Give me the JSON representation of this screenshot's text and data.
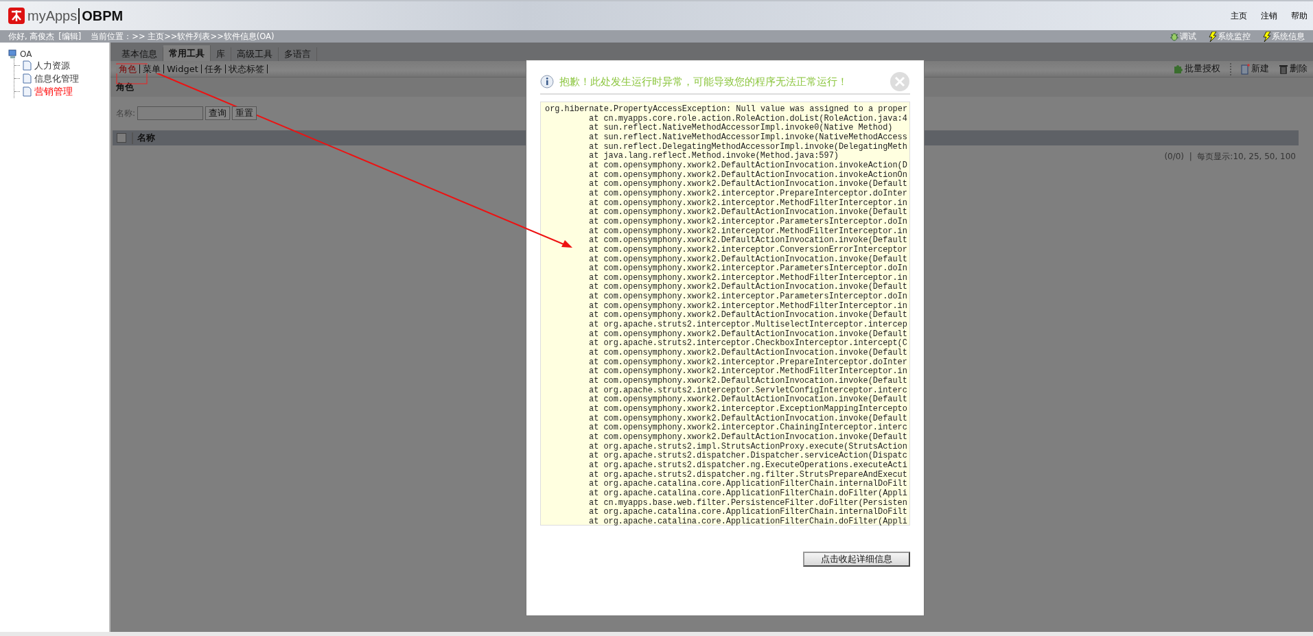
{
  "header": {
    "logo_text": "myApps",
    "product": "OBPM",
    "links": [
      "主页",
      "注销",
      "帮助"
    ]
  },
  "info_bar": {
    "greeting": "你好, 高俊杰",
    "edit_link": "[编辑]",
    "location": "当前位置：>> 主页>>软件列表>>软件信息(OA)",
    "tools": [
      {
        "kind": "debug",
        "label": "调试"
      },
      {
        "kind": "bolt",
        "label": "系统监控"
      },
      {
        "kind": "bolt",
        "label": "系统信息"
      }
    ]
  },
  "sidebar": {
    "root": "OA",
    "children": [
      {
        "label": "人力资源",
        "selected": false
      },
      {
        "label": "信息化管理",
        "selected": false
      },
      {
        "label": "营销管理",
        "selected": true
      }
    ]
  },
  "tabs": [
    {
      "label": "基本信息",
      "selected": false
    },
    {
      "label": "常用工具",
      "selected": true
    },
    {
      "label": "库",
      "selected": false
    },
    {
      "label": "高级工具",
      "selected": false
    },
    {
      "label": "多语言",
      "selected": false
    }
  ],
  "subtabs": [
    {
      "label": "角色",
      "selected": true
    },
    {
      "label": "菜单",
      "selected": false
    },
    {
      "label": "Widget",
      "selected": false
    },
    {
      "label": "任务",
      "selected": false
    },
    {
      "label": "状态标签",
      "selected": false
    }
  ],
  "toolbar": [
    {
      "kind": "puzzle",
      "label": "批量授权"
    },
    {
      "kind": "new",
      "label": "新建"
    },
    {
      "kind": "trash",
      "label": "删除"
    }
  ],
  "section_title": "角色",
  "search": {
    "label": "名称:",
    "buttons": [
      "查询",
      "重置"
    ]
  },
  "table": {
    "columns": [
      "名称"
    ],
    "select_all_checked": false
  },
  "pagination": "(0/0)  |  每页显示:10, 25, 50, 100",
  "dialog": {
    "title": "抱歉！此处发生运行时异常，可能导致您的程序无法正常运行！",
    "exception": "org.hibernate.PropertyAccessException: Null value was assigned to a proper",
    "frames": [
      "at cn.myapps.core.role.action.RoleAction.doList(RoleAction.java:4",
      "at sun.reflect.NativeMethodAccessorImpl.invoke0(Native Method)",
      "at sun.reflect.NativeMethodAccessorImpl.invoke(NativeMethodAccess",
      "at sun.reflect.DelegatingMethodAccessorImpl.invoke(DelegatingMeth",
      "at java.lang.reflect.Method.invoke(Method.java:597)",
      "at com.opensymphony.xwork2.DefaultActionInvocation.invokeAction(D",
      "at com.opensymphony.xwork2.DefaultActionInvocation.invokeActionOn",
      "at com.opensymphony.xwork2.DefaultActionInvocation.invoke(Default",
      "at com.opensymphony.xwork2.interceptor.PrepareInterceptor.doInter",
      "at com.opensymphony.xwork2.interceptor.MethodFilterInterceptor.in",
      "at com.opensymphony.xwork2.DefaultActionInvocation.invoke(Default",
      "at com.opensymphony.xwork2.interceptor.ParametersInterceptor.doIn",
      "at com.opensymphony.xwork2.interceptor.MethodFilterInterceptor.in",
      "at com.opensymphony.xwork2.DefaultActionInvocation.invoke(Default",
      "at com.opensymphony.xwork2.interceptor.ConversionErrorInterceptor",
      "at com.opensymphony.xwork2.DefaultActionInvocation.invoke(Default",
      "at com.opensymphony.xwork2.interceptor.ParametersInterceptor.doIn",
      "at com.opensymphony.xwork2.interceptor.MethodFilterInterceptor.in",
      "at com.opensymphony.xwork2.DefaultActionInvocation.invoke(Default",
      "at com.opensymphony.xwork2.interceptor.ParametersInterceptor.doIn",
      "at com.opensymphony.xwork2.interceptor.MethodFilterInterceptor.in",
      "at com.opensymphony.xwork2.DefaultActionInvocation.invoke(Default",
      "at org.apache.struts2.interceptor.MultiselectInterceptor.intercep",
      "at com.opensymphony.xwork2.DefaultActionInvocation.invoke(Default",
      "at org.apache.struts2.interceptor.CheckboxInterceptor.intercept(C",
      "at com.opensymphony.xwork2.DefaultActionInvocation.invoke(Default",
      "at com.opensymphony.xwork2.interceptor.PrepareInterceptor.doInter",
      "at com.opensymphony.xwork2.interceptor.MethodFilterInterceptor.in",
      "at com.opensymphony.xwork2.DefaultActionInvocation.invoke(Default",
      "at org.apache.struts2.interceptor.ServletConfigInterceptor.interc",
      "at com.opensymphony.xwork2.DefaultActionInvocation.invoke(Default",
      "at com.opensymphony.xwork2.interceptor.ExceptionMappingIntercepto",
      "at com.opensymphony.xwork2.DefaultActionInvocation.invoke(Default",
      "at com.opensymphony.xwork2.interceptor.ChainingInterceptor.interc",
      "at com.opensymphony.xwork2.DefaultActionInvocation.invoke(Default",
      "at org.apache.struts2.impl.StrutsActionProxy.execute(StrutsAction",
      "at org.apache.struts2.dispatcher.Dispatcher.serviceAction(Dispatc",
      "at org.apache.struts2.dispatcher.ng.ExecuteOperations.executeActi",
      "at org.apache.struts2.dispatcher.ng.filter.StrutsPrepareAndExecut",
      "at org.apache.catalina.core.ApplicationFilterChain.internalDoFilt",
      "at org.apache.catalina.core.ApplicationFilterChain.doFilter(Appli",
      "at cn.myapps.base.web.filter.PersistenceFilter.doFilter(Persisten",
      "at org.apache.catalina.core.ApplicationFilterChain.internalDoFilt",
      "at org.apache.catalina.core.ApplicationFilterChain.doFilter(Appli"
    ],
    "collapse_button": "点击收起详细信息"
  }
}
